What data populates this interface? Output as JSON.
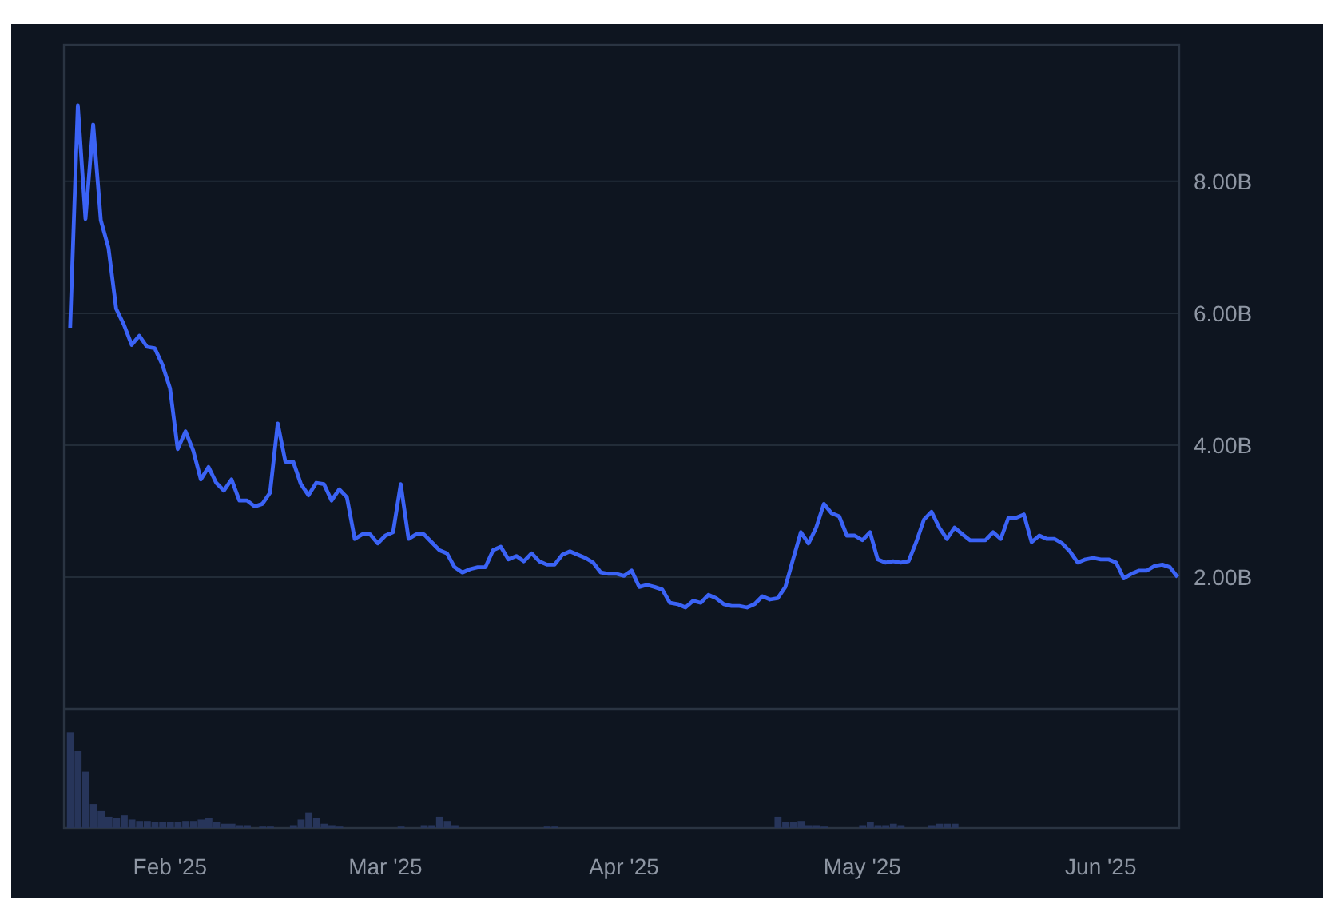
{
  "chart": {
    "chart_data": {
      "type": "line",
      "categories": [
        null,
        null,
        null,
        null,
        null,
        null,
        null,
        null,
        null,
        null,
        null,
        null,
        null,
        "Feb '25",
        null,
        null,
        null,
        null,
        null,
        null,
        null,
        null,
        null,
        null,
        null,
        null,
        null,
        null,
        null,
        null,
        null,
        null,
        null,
        null,
        null,
        null,
        null,
        null,
        null,
        null,
        null,
        "Mar '25",
        null,
        null,
        null,
        null,
        null,
        null,
        null,
        null,
        null,
        null,
        null,
        null,
        null,
        null,
        null,
        null,
        null,
        null,
        null,
        null,
        null,
        null,
        null,
        null,
        null,
        null,
        null,
        null,
        null,
        null,
        "Apr '25",
        null,
        null,
        null,
        null,
        null,
        null,
        null,
        null,
        null,
        null,
        null,
        null,
        null,
        null,
        null,
        null,
        null,
        null,
        null,
        null,
        null,
        null,
        null,
        null,
        null,
        null,
        null,
        null,
        null,
        null,
        "May '25",
        null,
        null,
        null,
        null,
        null,
        null,
        null,
        null,
        null,
        null,
        null,
        null,
        null,
        null,
        null,
        null,
        null,
        null,
        null,
        null,
        null,
        null,
        null,
        null,
        null,
        null,
        null,
        null,
        null,
        null,
        "Jun '25",
        null,
        null,
        null,
        null,
        null,
        null,
        null,
        null,
        null,
        null
      ],
      "series": [
        {
          "color": "#3b63f6",
          "values": [
            5.78,
            9.15,
            7.43,
            8.86,
            7.41,
            6.99,
            6.07,
            5.83,
            5.52,
            5.66,
            5.49,
            5.47,
            5.22,
            4.86,
            3.94,
            4.21,
            3.92,
            3.48,
            3.67,
            3.43,
            3.31,
            3.48,
            3.16,
            3.16,
            3.07,
            3.11,
            3.28,
            4.33,
            3.75,
            3.75,
            3.41,
            3.24,
            3.43,
            3.41,
            3.16,
            3.33,
            3.21,
            2.58,
            2.65,
            2.65,
            2.51,
            2.63,
            2.68,
            3.41,
            2.58,
            2.65,
            2.65,
            2.53,
            2.41,
            2.36,
            2.15,
            2.07,
            2.12,
            2.15,
            2.15,
            2.41,
            2.46,
            2.27,
            2.32,
            2.24,
            2.36,
            2.24,
            2.19,
            2.19,
            2.34,
            2.39,
            2.34,
            2.29,
            2.22,
            2.07,
            2.05,
            2.05,
            2.02,
            2.1,
            1.85,
            1.88,
            1.85,
            1.81,
            1.61,
            1.59,
            1.54,
            1.64,
            1.61,
            1.73,
            1.68,
            1.59,
            1.56,
            1.56,
            1.54,
            1.59,
            1.71,
            1.66,
            1.68,
            1.85,
            2.27,
            2.68,
            2.51,
            2.75,
            3.11,
            2.97,
            2.92,
            2.63,
            2.63,
            2.56,
            2.68,
            2.27,
            2.22,
            2.24,
            2.22,
            2.24,
            2.53,
            2.87,
            2.99,
            2.75,
            2.58,
            2.75,
            2.65,
            2.56,
            2.56,
            2.56,
            2.68,
            2.58,
            2.9,
            2.9,
            2.95,
            2.53,
            2.63,
            2.58,
            2.58,
            2.51,
            2.39,
            2.22,
            2.27,
            2.29,
            2.27,
            2.27,
            2.22,
            1.98,
            2.05,
            2.1,
            2.1,
            2.17,
            2.19,
            2.15,
            2.0
          ]
        }
      ],
      "ylim": [
        -1.805,
        10.07
      ],
      "grid": true,
      "yticks": [
        {
          "value": 2,
          "label": "2.00B"
        },
        {
          "value": 4,
          "label": "4.00B"
        },
        {
          "value": 6,
          "label": "6.00B"
        },
        {
          "value": 8,
          "label": "8.00B"
        }
      ]
    }
  }
}
